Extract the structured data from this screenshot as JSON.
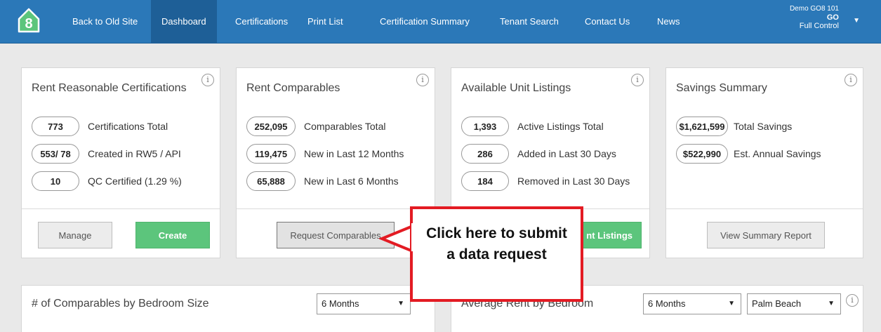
{
  "nav": {
    "logo_text": "8",
    "items": [
      "Back to Old Site",
      "Dashboard",
      "Certifications",
      "Print List",
      "Certification Summary",
      "Tenant Search",
      "Contact Us",
      "News"
    ],
    "active": "Dashboard",
    "user": {
      "name": "Demo GO8 101",
      "code": "GO",
      "role": "Full Control"
    }
  },
  "info_glyph": "i",
  "cards": {
    "certifications": {
      "title": "Rent Reasonable Certifications",
      "stats": [
        {
          "value": "773",
          "label": "Certifications Total"
        },
        {
          "value": "553/ 78",
          "label": "Created in RW5 / API"
        },
        {
          "value": "10",
          "label": "QC Certified (1.29 %)"
        }
      ],
      "buttons": {
        "manage": "Manage",
        "create": "Create"
      }
    },
    "comparables": {
      "title": "Rent Comparables",
      "stats": [
        {
          "value": "252,095",
          "label": "Comparables Total"
        },
        {
          "value": "119,475",
          "label": "New in Last 12 Months"
        },
        {
          "value": "65,888",
          "label": "New in Last 6 Months"
        }
      ],
      "buttons": {
        "request": "Request Comparables"
      }
    },
    "listings": {
      "title": "Available Unit Listings",
      "stats": [
        {
          "value": "1,393",
          "label": "Active Listings Total"
        },
        {
          "value": "286",
          "label": "Added in Last 30 Days"
        },
        {
          "value": "184",
          "label": "Removed in Last 30 Days"
        }
      ],
      "buttons": {
        "listings_partial": "nt Listings"
      }
    },
    "savings": {
      "title": "Savings Summary",
      "stats": [
        {
          "value": "$1,621,599",
          "label": "Total Savings"
        },
        {
          "value": "$522,990",
          "label": "Est. Annual Savings"
        }
      ],
      "buttons": {
        "report": "View Summary Report"
      }
    }
  },
  "charts": {
    "bedroom_size": {
      "title": "# of Comparables by Bedroom Size",
      "period": "6 Months"
    },
    "avg_rent": {
      "title_partial": "Average Rent by Bedroom",
      "period": "6 Months",
      "area": "Palm Beach"
    }
  },
  "callout": {
    "text": "Click here to submit a data request"
  },
  "colors": {
    "nav": "#2b78b8",
    "nav_active": "#1e5f97",
    "green": "#5cc57c",
    "callout_border": "#e31b23"
  }
}
